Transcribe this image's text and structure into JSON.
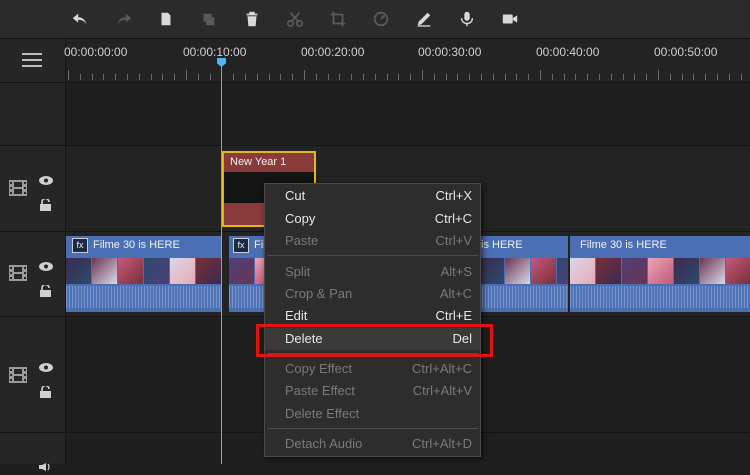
{
  "toolbar": {
    "icons": [
      "undo-icon",
      "redo-icon",
      "copy-icon",
      "paste-icon",
      "delete-icon",
      "cut-icon",
      "crop-icon",
      "speed-icon",
      "edit-icon",
      "microphone-icon",
      "record-icon"
    ]
  },
  "ruler": {
    "labels": [
      "00:00:00:00",
      "00:00:10:00",
      "00:00:20:00",
      "00:00:30:00",
      "00:00:40:00",
      "00:00:50:00"
    ]
  },
  "tracks": {
    "title_clip": "New Year 1",
    "video_clips": [
      "Filme 30 is HERE",
      "Fil",
      "is HERE",
      "Filme 30 is HERE"
    ],
    "fx_label": "fx"
  },
  "context_menu": {
    "items": [
      {
        "label": "Cut",
        "shortcut": "Ctrl+X"
      },
      {
        "label": "Copy",
        "shortcut": "Ctrl+C"
      },
      {
        "label": "Paste",
        "shortcut": "Ctrl+V"
      },
      {
        "label": "Split",
        "shortcut": "Alt+S"
      },
      {
        "label": "Crop & Pan",
        "shortcut": "Alt+C"
      },
      {
        "label": "Edit",
        "shortcut": "Ctrl+E"
      },
      {
        "label": "Delete",
        "shortcut": "Del"
      },
      {
        "label": "Copy Effect",
        "shortcut": "Ctrl+Alt+C"
      },
      {
        "label": "Paste Effect",
        "shortcut": "Ctrl+Alt+V"
      },
      {
        "label": "Delete Effect",
        "shortcut": ""
      },
      {
        "label": "Detach Audio",
        "shortcut": "Ctrl+Alt+D"
      }
    ]
  },
  "colors": {
    "accent": "#4cb5f5",
    "highlight": "#e01414",
    "title_clip": "#8b3a3a",
    "video_clip": "#4a6fb5"
  }
}
